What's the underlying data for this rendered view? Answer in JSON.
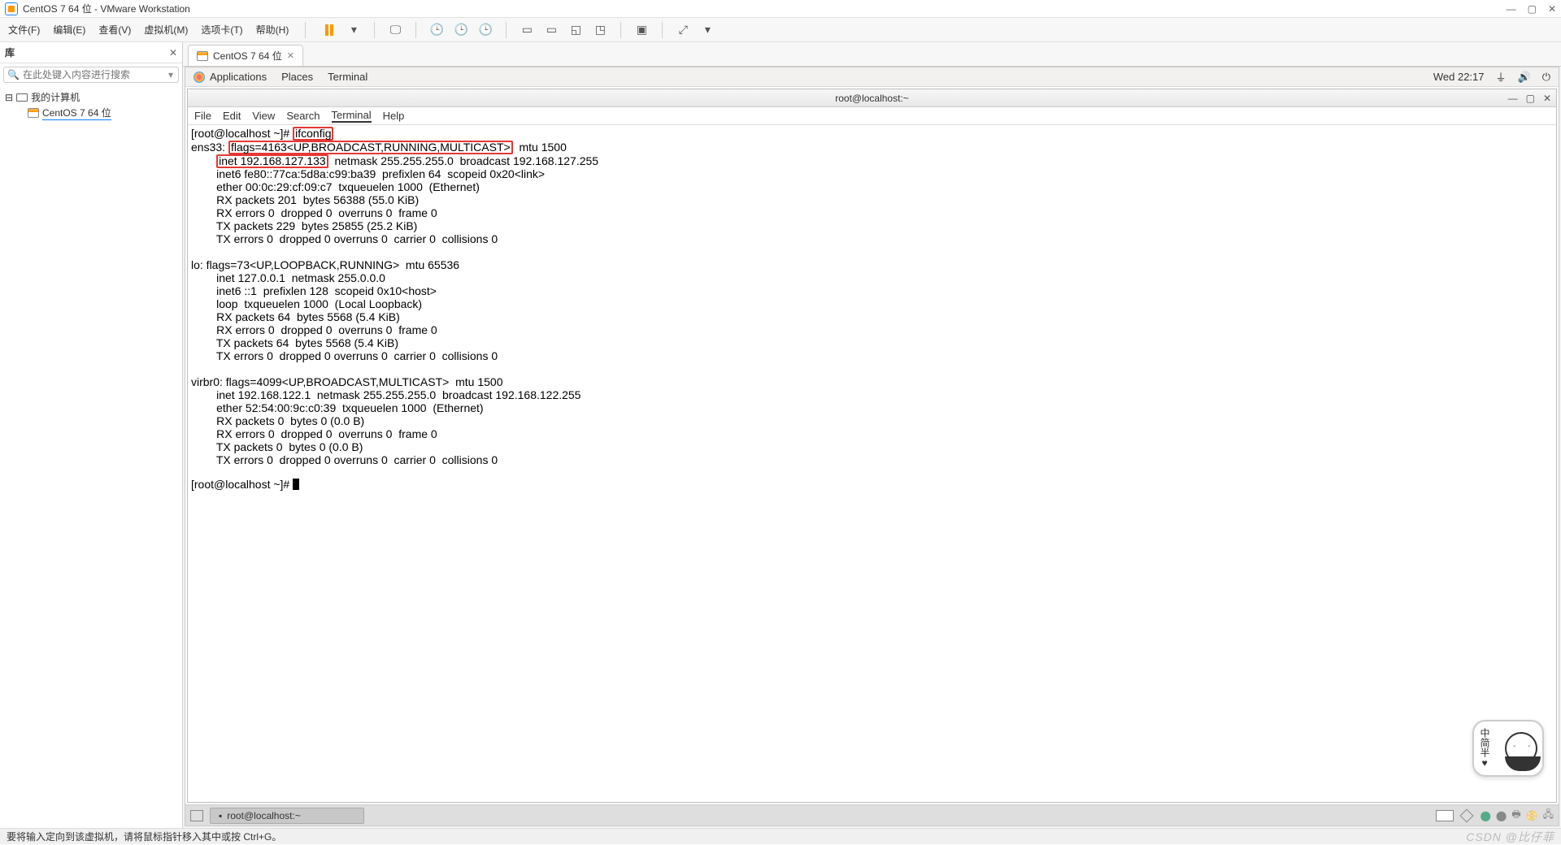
{
  "window": {
    "title": "CentOS 7 64 位 - VMware Workstation"
  },
  "main_menu": {
    "items": [
      "文件(F)",
      "编辑(E)",
      "查看(V)",
      "虚拟机(M)",
      "选项卡(T)",
      "帮助(H)"
    ]
  },
  "sidebar": {
    "title": "库",
    "search_placeholder": "在此处键入内容进行搜索",
    "tree": {
      "root": "我的计算机",
      "child": "CentOS 7 64 位"
    }
  },
  "tab": {
    "label": "CentOS 7 64 位"
  },
  "gnome": {
    "top": {
      "applications": "Applications",
      "places": "Places",
      "terminal": "Terminal",
      "clock": "Wed 22:17"
    },
    "taskbar": {
      "app": "root@localhost:~"
    }
  },
  "terminal": {
    "title": "root@localhost:~",
    "menu": [
      "File",
      "Edit",
      "View",
      "Search",
      "Terminal",
      "Help"
    ],
    "prompt1_pre": "[root@localhost ~]# ",
    "prompt1_cmd": "ifconfig",
    "ens_pre": "ens33: ",
    "ens_hl": "flags=4163<UP,BROADCAST,RUNNING,MULTICAST>",
    "ens_post": "  mtu 1500",
    "inet_pre": "        ",
    "inet_hl": "inet 192.168.127.133",
    "inet_post": "  netmask 255.255.255.0  broadcast 192.168.127.255",
    "rest1": "        inet6 fe80::77ca:5d8a:c99:ba39  prefixlen 64  scopeid 0x20<link>\n        ether 00:0c:29:cf:09:c7  txqueuelen 1000  (Ethernet)\n        RX packets 201  bytes 56388 (55.0 KiB)\n        RX errors 0  dropped 0  overruns 0  frame 0\n        TX packets 229  bytes 25855 (25.2 KiB)\n        TX errors 0  dropped 0 overruns 0  carrier 0  collisions 0\n\nlo: flags=73<UP,LOOPBACK,RUNNING>  mtu 65536\n        inet 127.0.0.1  netmask 255.0.0.0\n        inet6 ::1  prefixlen 128  scopeid 0x10<host>\n        loop  txqueuelen 1000  (Local Loopback)\n        RX packets 64  bytes 5568 (5.4 KiB)\n        RX errors 0  dropped 0  overruns 0  frame 0\n        TX packets 64  bytes 5568 (5.4 KiB)\n        TX errors 0  dropped 0 overruns 0  carrier 0  collisions 0\n\nvirbr0: flags=4099<UP,BROADCAST,MULTICAST>  mtu 1500\n        inet 192.168.122.1  netmask 255.255.255.0  broadcast 192.168.122.255\n        ether 52:54:00:9c:c0:39  txqueuelen 1000  (Ethernet)\n        RX packets 0  bytes 0 (0.0 B)\n        RX errors 0  dropped 0  overruns 0  frame 0\n        TX packets 0  bytes 0 (0.0 B)\n        TX errors 0  dropped 0 overruns 0  carrier 0  collisions 0\n",
    "prompt2": "[root@localhost ~]# "
  },
  "statusbar": {
    "tip": "要将输入定向到该虚拟机，请将鼠标指针移入其中或按 Ctrl+G。",
    "watermark": "CSDN @比仔菲"
  },
  "ime": {
    "text": "中简半♥"
  }
}
